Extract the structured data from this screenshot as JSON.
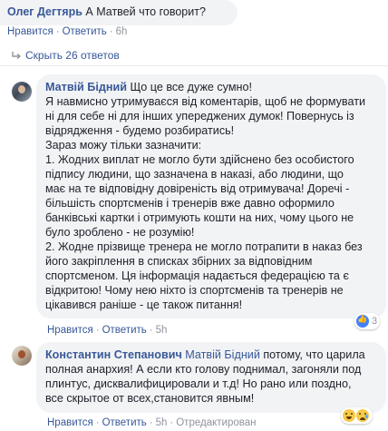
{
  "top_comment": {
    "author": "Олег Дегтярь",
    "text": "А Матвей что говорит?",
    "like": "Нравится",
    "reply": "Ответить",
    "time": "6h"
  },
  "replies_toggle": {
    "label": "Скрыть 26 ответов",
    "icon": "reply-arrow-icon"
  },
  "comment1": {
    "author": "Матвій Бідний",
    "lines": [
      "Що це все дуже сумно!",
      "Я навмисно утримуваєся від коментарів, щоб не формувати",
      "ні для себе ні для інших упереджених думок! Повернусь із",
      "відрядження - будемо розбиратись!",
      "Зараз можу тільки зазначити:",
      "1. Жодних виплат не могло бути здійснено без особистого",
      "підпису людини, що зазначена в наказі, або людини, що",
      "має на те відповідну довіреність від отримувача! Доречі -",
      "більшість спортсменів і тренерів вже давно оформило",
      "банківські картки і отримують кошти на них, чому цього не",
      "було зроблено - не розумію!",
      "2. Жодне прізвище тренера не могло потрапити в наказ без",
      "його закріплення в списках збірних за відповідним",
      "спортсменом. Ця інформація надається федерацією та є",
      "відкритою! Чому нею ніхто із спортсменів та тренерів не",
      "цікавився раніше - це також питання!"
    ],
    "like": "Нравится",
    "reply": "Ответить",
    "time": "5h",
    "reaction_count": "3",
    "reaction_icon": "like-icon"
  },
  "comment2": {
    "author": "Константин Степанович",
    "mention": "Матвій Бідний",
    "first_line_rest": "потому, что царила",
    "lines": [
      "полная анархия! А если кто голову поднимал, загоняли под",
      "плинтус, дисквалифицировали и т.д! Но рано или поздно,",
      "все скрытое от всех,становится явным!"
    ],
    "like": "Нравится",
    "reply": "Ответить",
    "time": "5h",
    "edited": "Отредактирован",
    "reaction_icons": [
      "laugh-icon",
      "sad-icon"
    ]
  }
}
